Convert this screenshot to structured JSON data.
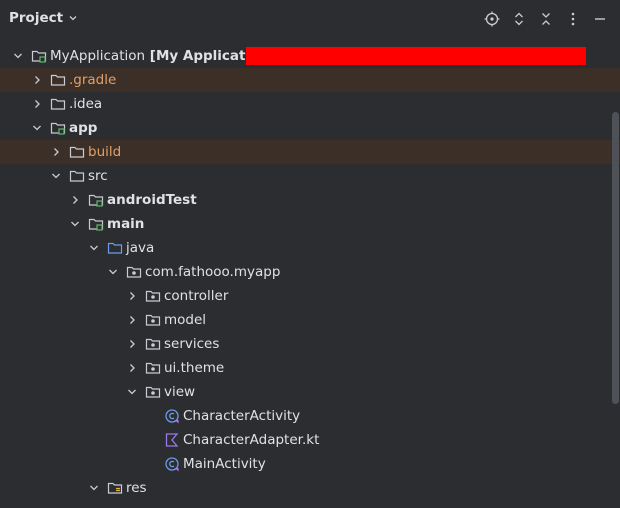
{
  "header": {
    "title": "Project"
  },
  "colors": {
    "background": "#2b2d30",
    "excluded_bg": "#3b2f28",
    "excluded_text": "#e0a06b",
    "folder_blue": "#6c9be8",
    "redaction": "#ff0000"
  },
  "tree": [
    {
      "label": "MyApplication",
      "suffix": "[My Application]",
      "chev": "down",
      "icon": "module-folder-icon",
      "excluded": false,
      "redacted": true
    },
    {
      "label": ".gradle",
      "chev": "right",
      "icon": "folder-icon",
      "excluded": true
    },
    {
      "label": ".idea",
      "chev": "right",
      "icon": "folder-icon",
      "excluded": false
    },
    {
      "label": "app",
      "chev": "down",
      "icon": "module-folder-icon",
      "bold": true
    },
    {
      "label": "build",
      "chev": "right",
      "icon": "folder-icon",
      "excluded": true
    },
    {
      "label": "src",
      "chev": "down",
      "icon": "folder-icon"
    },
    {
      "label": "androidTest",
      "chev": "right",
      "icon": "module-folder-icon",
      "bold": true
    },
    {
      "label": "main",
      "chev": "down",
      "icon": "module-folder-icon",
      "bold": true
    },
    {
      "label": "java",
      "chev": "down",
      "icon": "source-folder-icon"
    },
    {
      "label": "com.fathooo.myapp",
      "chev": "down",
      "icon": "package-icon"
    },
    {
      "label": "controller",
      "chev": "right",
      "icon": "package-icon"
    },
    {
      "label": "model",
      "chev": "right",
      "icon": "package-icon"
    },
    {
      "label": "services",
      "chev": "right",
      "icon": "package-icon"
    },
    {
      "label": "ui.theme",
      "chev": "right",
      "icon": "package-icon"
    },
    {
      "label": "view",
      "chev": "down",
      "icon": "package-icon"
    },
    {
      "label": "CharacterActivity",
      "chev": "none",
      "icon": "kotlin-class-icon"
    },
    {
      "label": "CharacterAdapter.kt",
      "chev": "none",
      "icon": "kotlin-file-icon"
    },
    {
      "label": "MainActivity",
      "chev": "none",
      "icon": "kotlin-class-icon"
    },
    {
      "label": "res",
      "chev": "down",
      "icon": "resources-folder-icon"
    }
  ]
}
